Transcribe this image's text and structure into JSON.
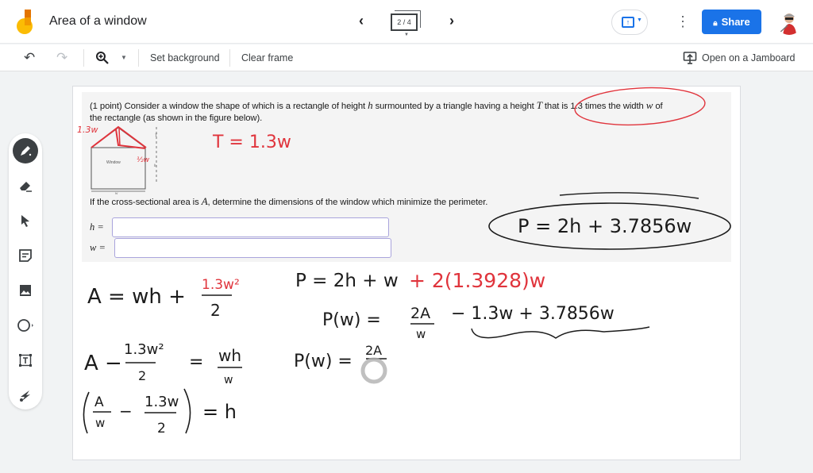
{
  "app": {
    "title": "Area of a window",
    "frame_indicator": "2 / 4",
    "share_label": "Share",
    "icons": {
      "logo": "jamboard-logo-icon",
      "prev": "chevron-left-icon",
      "next": "chevron-right-icon",
      "present": "present-upload-icon",
      "more": "more-vert-icon",
      "lock": "lock-icon"
    }
  },
  "toolbar": {
    "undo": "undo-icon",
    "redo": "redo-icon",
    "zoom": "zoom-in-icon",
    "set_background": "Set background",
    "clear_frame": "Clear frame",
    "open_on_jamboard": "Open on a Jamboard"
  },
  "tools": [
    {
      "name": "pen",
      "icon": "pen-icon",
      "active": true
    },
    {
      "name": "eraser",
      "icon": "eraser-icon",
      "active": false
    },
    {
      "name": "select",
      "icon": "cursor-icon",
      "active": false
    },
    {
      "name": "sticky-note",
      "icon": "sticky-note-icon",
      "active": false
    },
    {
      "name": "image",
      "icon": "image-icon",
      "active": false
    },
    {
      "name": "circle",
      "icon": "circle-icon",
      "active": false
    },
    {
      "name": "text-box",
      "icon": "text-box-icon",
      "active": false
    },
    {
      "name": "laser",
      "icon": "laser-icon",
      "active": false
    }
  ],
  "problem": {
    "line1_a": "(1 point) Consider a window the shape of which is a rectangle of height ",
    "var_h": "h",
    "line1_b": " surmounted by a triangle having a height ",
    "var_T": "T",
    "line1_c": " that is 1.3 times the width ",
    "var_w": "w",
    "line1_d": " of",
    "line2": "the rectangle (as shown in the figure below).",
    "line3_a": "If the cross-sectional area is ",
    "var_A": "A",
    "line3_b": ", determine the dimensions of the window which minimize the perimeter.",
    "figure_label": "Window",
    "h_label": "h =",
    "w_label": "w =",
    "h_value": "",
    "w_value": ""
  },
  "annotations": {
    "fig_side": "1.3w",
    "fig_half": "½w",
    "T_eq": "T = 1.3w",
    "P_boxed": "P = 2h + 3.7856w",
    "A_eq_lhs": "A = wh +",
    "A_eq_num": "1.3w²",
    "A_eq_den": "2",
    "P_eq_black": "P = 2h + w",
    "P_eq_red": "+ 2(1.3928)w",
    "Pw_lhs": "P(w) =",
    "Pw_num": "2A",
    "Pw_den": "w",
    "Pw_rest": "− 1.3w + 3.7856w",
    "A_minus_lhs": "A −",
    "A_minus_num": "1.3w²",
    "A_minus_den": "2",
    "eq": "=",
    "wh_num": "wh",
    "wh_den": "w",
    "Pw2_lhs": "P(w) =",
    "Pw2_num": "2A",
    "h_paren_num1": "A",
    "h_paren_den1": "w",
    "minus": "−",
    "h_paren_num2": "1.3w",
    "h_paren_den2": "2",
    "h_result": "= h"
  },
  "colors": {
    "accent": "#1a73e8",
    "ink_black": "#1b1b1b",
    "ink_red": "#e0343c",
    "input_border": "#a9a4dc"
  }
}
